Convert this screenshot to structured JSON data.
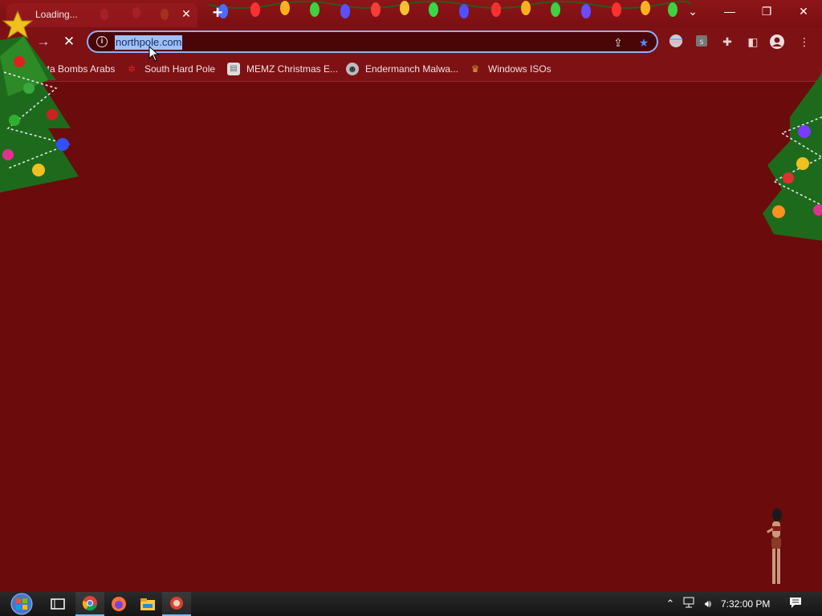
{
  "tab": {
    "title": "Loading...",
    "close_icon": "close-icon",
    "new_tab_icon": "plus-icon"
  },
  "window_controls": {
    "tab_search_icon": "chevron-down-icon",
    "minimize_icon": "minimize-icon",
    "restore_icon": "restore-icon",
    "close_icon": "close-icon"
  },
  "toolbar": {
    "back_icon": "arrow-left-icon",
    "forward_icon": "arrow-right-icon",
    "stop_icon": "stop-icon",
    "url": "northpole.com",
    "info_icon": "info-icon",
    "share_icon": "share-icon",
    "bookmark_star_icon": "star-icon"
  },
  "bookmarks": [
    {
      "label": "ata Bombs Arabs",
      "icon": "bookmark-icon"
    },
    {
      "label": "South Hard Pole",
      "icon": "snowflake-icon"
    },
    {
      "label": "MEMZ Christmas E...",
      "icon": "page-icon"
    },
    {
      "label": "Endermanch Malwa...",
      "icon": "raccoon-icon"
    },
    {
      "label": "Windows ISOs",
      "icon": "buddha-icon"
    }
  ],
  "taskbar": {
    "clock": "7:32:00 PM",
    "start_icon": "windows-start-icon",
    "task_view_icon": "task-view-icon",
    "apps": [
      "chrome-icon",
      "firefox-icon",
      "file-explorer-icon",
      "app-icon"
    ]
  },
  "colors": {
    "page_background": "#6b0b0b",
    "chrome_frame": "#7d1114",
    "url_selection": "#9fc0ff",
    "bookmark_star": "#4d8cff"
  }
}
